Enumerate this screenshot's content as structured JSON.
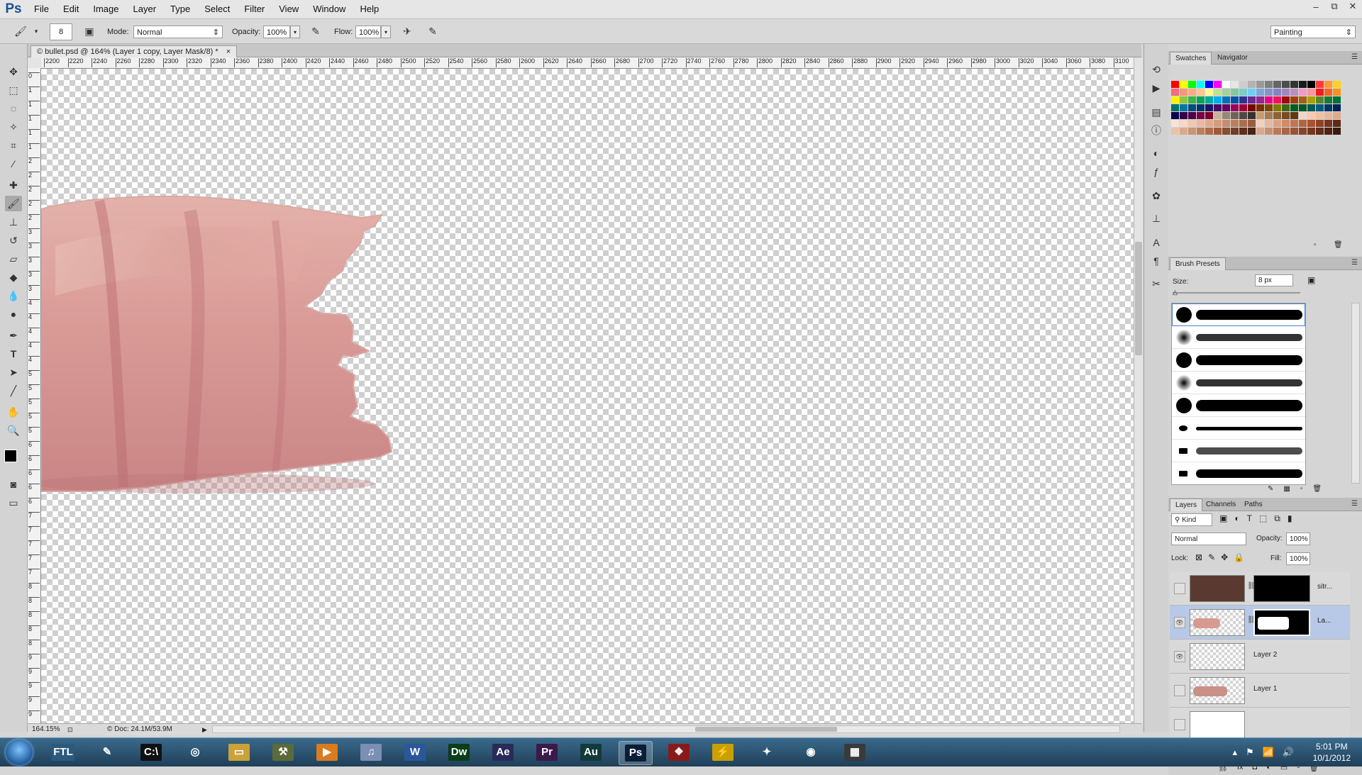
{
  "app": {
    "logo": "Ps"
  },
  "menu": [
    "File",
    "Edit",
    "Image",
    "Layer",
    "Type",
    "Select",
    "Filter",
    "View",
    "Window",
    "Help"
  ],
  "window_controls": {
    "minimize": "–",
    "restore": "⧉",
    "close": "✕"
  },
  "options_bar": {
    "brush_size": "8",
    "mode_label": "Mode:",
    "mode_value": "Normal",
    "opacity_label": "Opacity:",
    "opacity_value": "100%",
    "flow_label": "Flow:",
    "flow_value": "100%",
    "workspace": "Painting"
  },
  "document": {
    "tab_title": "© bullet.psd @ 164% (Layer 1 copy, Layer Mask/8) *",
    "close": "×",
    "zoom": "164.15%",
    "doc_info": "Doc: 24.1M/53.9M",
    "ruler_h": [
      "2200",
      "2220",
      "2240",
      "2260",
      "2280",
      "2300",
      "2320",
      "2340",
      "2360",
      "2380",
      "2400",
      "2420",
      "2440",
      "2460",
      "2480",
      "2500",
      "2520",
      "2540",
      "2560",
      "2580",
      "2600",
      "2620",
      "2640",
      "2660",
      "2680",
      "2700",
      "2720",
      "2740",
      "2760",
      "2780",
      "2800",
      "2820",
      "2840",
      "2860",
      "2880",
      "2900",
      "2920",
      "2940",
      "2960",
      "2980",
      "3000",
      "3020",
      "3040",
      "3060",
      "3080",
      "3100",
      "31"
    ],
    "ruler_v": [
      "0",
      "1",
      "1",
      "1",
      "1",
      "1",
      "2",
      "2",
      "2",
      "2",
      "2",
      "3",
      "3",
      "3",
      "3",
      "3",
      "4",
      "4",
      "4",
      "4",
      "4",
      "5",
      "5",
      "5",
      "5",
      "5",
      "6",
      "6",
      "6",
      "6",
      "6",
      "7",
      "7",
      "7",
      "7",
      "7",
      "8",
      "8",
      "8",
      "8",
      "8",
      "9",
      "9",
      "9",
      "9",
      "9"
    ]
  },
  "swatches_panel": {
    "tabs": [
      "Swatches",
      "Navigator"
    ],
    "colors": [
      "#ff0000",
      "#ffff00",
      "#00ff00",
      "#00ffff",
      "#0000ff",
      "#ff00ff",
      "#ffffff",
      "#e6e6e6",
      "#cccccc",
      "#b3b3b3",
      "#999999",
      "#808080",
      "#666666",
      "#4d4d4d",
      "#333333",
      "#1a1a1a",
      "#000000",
      "#ff3b3b",
      "#ff9933",
      "#ffd11a",
      "#f26d7d",
      "#f7977a",
      "#fbad82",
      "#fdc68a",
      "#fff79a",
      "#c4df9b",
      "#a2d39c",
      "#82ca9d",
      "#7bcdc8",
      "#6ecff6",
      "#7ea7d8",
      "#8493ca",
      "#8882be",
      "#a187be",
      "#bc8dbf",
      "#f49ac2",
      "#f6989d",
      "#ed1c24",
      "#f26522",
      "#f7941d",
      "#fff200",
      "#8dc73f",
      "#39b54a",
      "#00a651",
      "#00a99d",
      "#00aeef",
      "#0072bc",
      "#0054a6",
      "#2e3192",
      "#662d91",
      "#92278f",
      "#ec008c",
      "#ed145b",
      "#9e0b0f",
      "#a0410d",
      "#a3620a",
      "#aba000",
      "#598527",
      "#197b30",
      "#007236",
      "#00746b",
      "#0076a3",
      "#004a80",
      "#003471",
      "#1b1464",
      "#440e62",
      "#630460",
      "#9e005d",
      "#9e0039",
      "#790000",
      "#7b2e00",
      "#7d4900",
      "#827b00",
      "#406618",
      "#005e20",
      "#005826",
      "#005952",
      "#005b7f",
      "#003663",
      "#002157",
      "#0d004c",
      "#32004b",
      "#4b0049",
      "#7b0046",
      "#7a0026",
      "#c7b299",
      "#998675",
      "#736357",
      "#534741",
      "#37302d",
      "#c69c6d",
      "#a67c52",
      "#8c6239",
      "#754c24",
      "#603913",
      "#f2d5c4",
      "#f5c9b5",
      "#efc1a4",
      "#e8b79a",
      "#ddab8a",
      "#f7e2d8",
      "#f9d7c7",
      "#f2c6b0",
      "#ecb89f",
      "#e0aa8e",
      "#d49c7c",
      "#c88c6b",
      "#bd7d5c",
      "#ab6d4d",
      "#9a5d3f",
      "#f6d0bd",
      "#e9b7a0",
      "#dca083",
      "#cf8b6a",
      "#c27653",
      "#b5633f",
      "#a8532e",
      "#8f4324",
      "#76361d",
      "#5e2a17",
      "#e8c3a9",
      "#d9ab8e",
      "#cb9475",
      "#bd7f5e",
      "#ae6b4a",
      "#a05a3a",
      "#8b4b2f",
      "#743d26",
      "#5e301e",
      "#472417",
      "#d7a98b",
      "#c79072",
      "#b87a5c",
      "#a86648",
      "#985437",
      "#884429",
      "#753720",
      "#612c19",
      "#4d2213",
      "#3a190e"
    ]
  },
  "brush_panel": {
    "tab": "Brush Presets",
    "size_label": "Size:",
    "size_value": "8 px"
  },
  "layers_panel": {
    "tabs": [
      "Layers",
      "Channels",
      "Paths"
    ],
    "kind_label": "Kind",
    "blend_mode": "Normal",
    "opacity_label": "Opacity:",
    "opacity_value": "100%",
    "lock_label": "Lock:",
    "fill_label": "Fill:",
    "fill_value": "100%",
    "layers": [
      {
        "name": "sitr...",
        "visible": false,
        "selected": false
      },
      {
        "name": "La...",
        "visible": true,
        "selected": true
      },
      {
        "name": "Layer 2",
        "visible": true,
        "selected": false
      },
      {
        "name": "Layer 1",
        "visible": false,
        "selected": false
      }
    ]
  },
  "taskbar": {
    "apps": [
      {
        "id": "ftl",
        "label": "FTL"
      },
      {
        "id": "pen",
        "label": "✎"
      },
      {
        "id": "cmd",
        "label": "C:\\"
      },
      {
        "id": "avast",
        "label": "◎"
      },
      {
        "id": "explorer",
        "label": "▭"
      },
      {
        "id": "tools",
        "label": "⚒"
      },
      {
        "id": "media",
        "label": "▶"
      },
      {
        "id": "itunes",
        "label": "♫"
      },
      {
        "id": "word",
        "label": "W"
      },
      {
        "id": "dreamweaver",
        "label": "Dw"
      },
      {
        "id": "aftereffects",
        "label": "Ae"
      },
      {
        "id": "premiere",
        "label": "Pr"
      },
      {
        "id": "audition",
        "label": "Au"
      },
      {
        "id": "photoshop",
        "label": "Ps"
      },
      {
        "id": "raven",
        "label": "❖"
      },
      {
        "id": "winamp",
        "label": "⚡"
      },
      {
        "id": "razer",
        "label": "✦"
      },
      {
        "id": "chrome",
        "label": "◉"
      },
      {
        "id": "files",
        "label": "▦"
      }
    ],
    "time": "5:01 PM",
    "date": "10/1/2012"
  }
}
